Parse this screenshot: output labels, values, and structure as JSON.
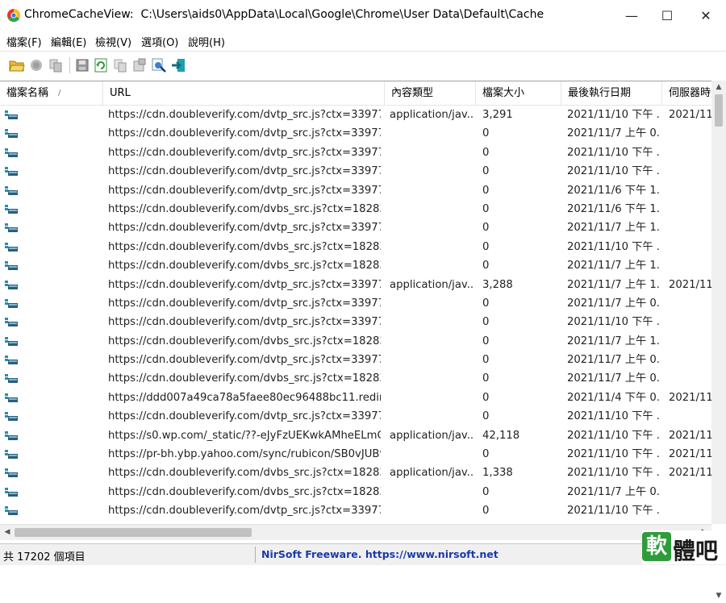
{
  "window": {
    "app_name": "ChromeCacheView:",
    "path": "C:\\Users\\aids0\\AppData\\Local\\Google\\Chrome\\User Data\\Default\\Cache",
    "minimize": "—",
    "maximize": "☐",
    "close": "✕"
  },
  "menu": [
    "檔案(F)",
    "編輯(E)",
    "檢視(V)",
    "選項(O)",
    "說明(H)"
  ],
  "toolbar": {
    "icons": [
      "open-folder-icon",
      "stop-icon",
      "copy-files-icon",
      "save-icon",
      "refresh-icon",
      "copy-icon",
      "properties-icon",
      "open-link-icon",
      "exit-icon"
    ]
  },
  "columns": {
    "name": "檔案名稱",
    "sort_indicator": "/",
    "url": "URL",
    "content_type": "內容類型",
    "size": "檔案大小",
    "last_accessed": "最後執行日期",
    "server_time": "伺服器時"
  },
  "rows": [
    {
      "url": "https://cdn.doubleverify.com/dvtp_src.js?ctx=3397726...",
      "type": "application/jav...",
      "size": "3,291",
      "date": "2021/11/10 下午 ...",
      "server": "2021/11/"
    },
    {
      "url": "https://cdn.doubleverify.com/dvtp_src.js?ctx=3397726...",
      "type": "",
      "size": "0",
      "date": "2021/11/7 上午 0...",
      "server": ""
    },
    {
      "url": "https://cdn.doubleverify.com/dvtp_src.js?ctx=3397726...",
      "type": "",
      "size": "0",
      "date": "2021/11/10 下午 ...",
      "server": ""
    },
    {
      "url": "https://cdn.doubleverify.com/dvtp_src.js?ctx=3397726...",
      "type": "",
      "size": "0",
      "date": "2021/11/10 下午 ...",
      "server": ""
    },
    {
      "url": "https://cdn.doubleverify.com/dvtp_src.js?ctx=3397726...",
      "type": "",
      "size": "0",
      "date": "2021/11/6 下午 1...",
      "server": ""
    },
    {
      "url": "https://cdn.doubleverify.com/dvbs_src.js?ctx=1828362...",
      "type": "",
      "size": "0",
      "date": "2021/11/6 下午 1...",
      "server": ""
    },
    {
      "url": "https://cdn.doubleverify.com/dvtp_src.js?ctx=3397726...",
      "type": "",
      "size": "0",
      "date": "2021/11/7 上午 1...",
      "server": ""
    },
    {
      "url": "https://cdn.doubleverify.com/dvbs_src.js?ctx=1828362...",
      "type": "",
      "size": "0",
      "date": "2021/11/10 下午 ...",
      "server": ""
    },
    {
      "url": "https://cdn.doubleverify.com/dvbs_src.js?ctx=1828362...",
      "type": "",
      "size": "0",
      "date": "2021/11/7 上午 1...",
      "server": ""
    },
    {
      "url": "https://cdn.doubleverify.com/dvtp_src.js?ctx=3397726...",
      "type": "application/jav...",
      "size": "3,288",
      "date": "2021/11/7 上午 1...",
      "server": "2021/11/"
    },
    {
      "url": "https://cdn.doubleverify.com/dvtp_src.js?ctx=3397726...",
      "type": "",
      "size": "0",
      "date": "2021/11/7 上午 0...",
      "server": ""
    },
    {
      "url": "https://cdn.doubleverify.com/dvtp_src.js?ctx=3397726...",
      "type": "",
      "size": "0",
      "date": "2021/11/10 下午 ...",
      "server": ""
    },
    {
      "url": "https://cdn.doubleverify.com/dvbs_src.js?ctx=1828362...",
      "type": "",
      "size": "0",
      "date": "2021/11/7 上午 1...",
      "server": ""
    },
    {
      "url": "https://cdn.doubleverify.com/dvtp_src.js?ctx=3397726...",
      "type": "",
      "size": "0",
      "date": "2021/11/7 上午 0...",
      "server": ""
    },
    {
      "url": "https://cdn.doubleverify.com/dvbs_src.js?ctx=1828362...",
      "type": "",
      "size": "0",
      "date": "2021/11/7 上午 0...",
      "server": ""
    },
    {
      "url": "https://ddd007a49ca78a5faee80ec96488bc11.redinui...",
      "type": "",
      "size": "0",
      "date": "2021/11/4 下午 0...",
      "server": "2021/11/"
    },
    {
      "url": "https://cdn.doubleverify.com/dvtp_src.js?ctx=3397726...",
      "type": "",
      "size": "0",
      "date": "2021/11/10 下午 ...",
      "server": ""
    },
    {
      "url": "https://s0.wp.com/_static/??-eJyFzUEKwkAMheELmQ4...",
      "type": "application/jav...",
      "size": "42,118",
      "date": "2021/11/10 下午 ...",
      "server": "2021/11/"
    },
    {
      "url": "https://pr-bh.ybp.yahoo.com/sync/rubicon/SB0vJUB9o...",
      "type": "",
      "size": "0",
      "date": "2021/11/10 下午 ...",
      "server": "2021/11/"
    },
    {
      "url": "https://cdn.doubleverify.com/dvbs_src.js?ctx=1828362...",
      "type": "application/jav...",
      "size": "1,338",
      "date": "2021/11/10 下午 ...",
      "server": "2021/11/"
    },
    {
      "url": "https://cdn.doubleverify.com/dvbs_src.js?ctx=1828362...",
      "type": "",
      "size": "0",
      "date": "2021/11/7 上午 0...",
      "server": ""
    },
    {
      "url": "https://cdn.doubleverify.com/dvtp_src.js?ctx=3397726...",
      "type": "",
      "size": "0",
      "date": "2021/11/10 下午 ...",
      "server": ""
    }
  ],
  "status": {
    "count": "共 17202 個項目",
    "link": "NirSoft Freeware. https://www.nirsoft.net"
  },
  "watermark": {
    "badge": "軟",
    "text": "體吧"
  },
  "colors": {
    "link_blue": "#1a3ba8",
    "watermark_green": "#2e9c3a",
    "row_icon_teal": "#1f8fb5"
  }
}
